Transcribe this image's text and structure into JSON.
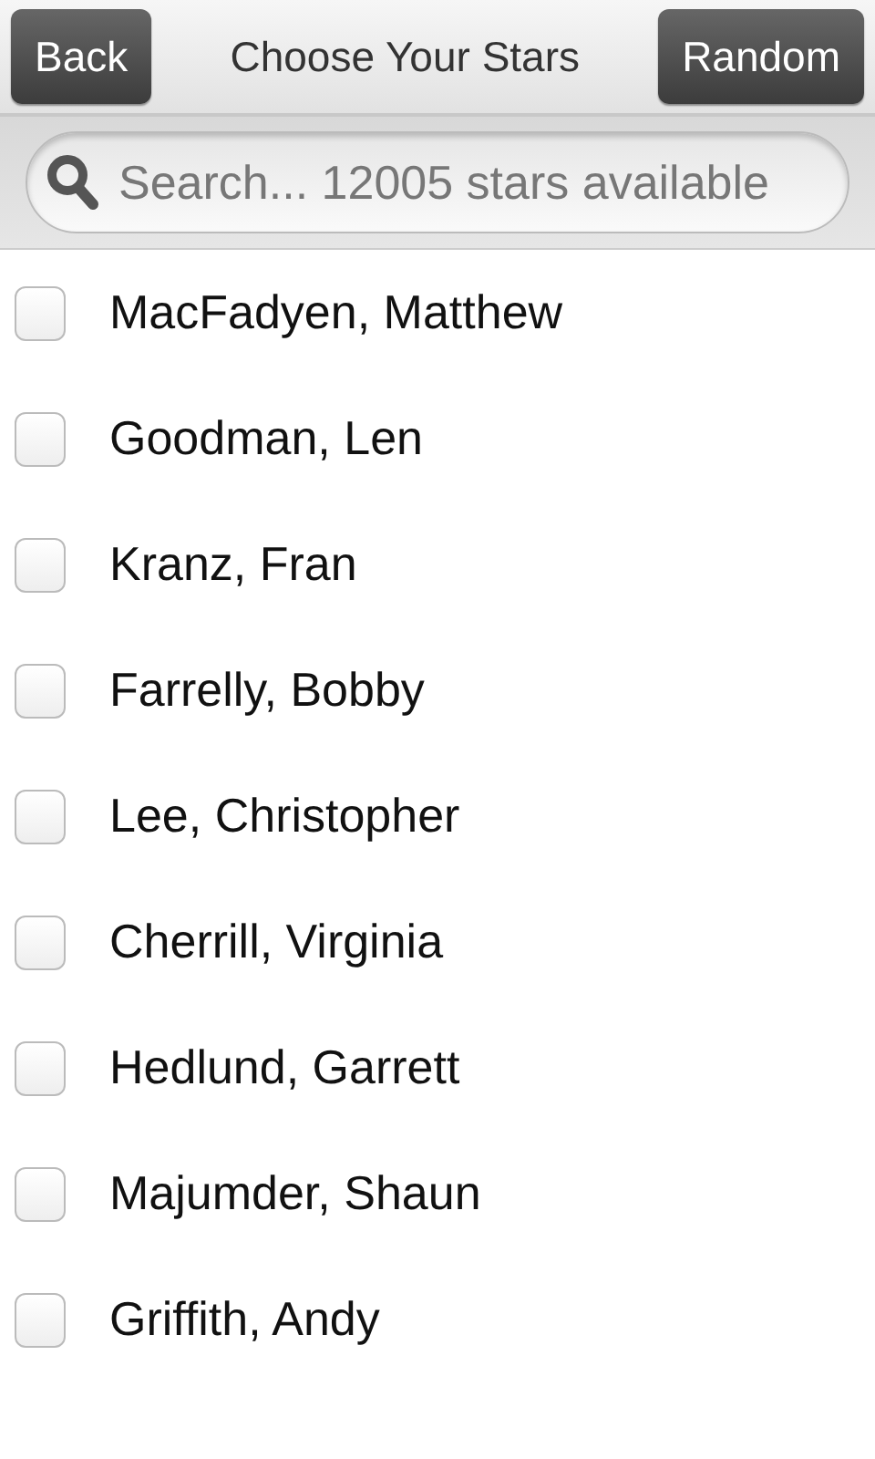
{
  "header": {
    "back": "Back",
    "title": "Choose Your Stars",
    "random": "Random"
  },
  "search": {
    "placeholder": "Search... 12005 stars available"
  },
  "stars": [
    {
      "name": "MacFadyen, Matthew",
      "checked": false
    },
    {
      "name": "Goodman, Len",
      "checked": false
    },
    {
      "name": "Kranz, Fran",
      "checked": false
    },
    {
      "name": "Farrelly, Bobby",
      "checked": false
    },
    {
      "name": "Lee, Christopher",
      "checked": false
    },
    {
      "name": "Cherrill, Virginia",
      "checked": false
    },
    {
      "name": "Hedlund, Garrett",
      "checked": false
    },
    {
      "name": "Majumder, Shaun",
      "checked": false
    },
    {
      "name": "Griffith, Andy",
      "checked": false
    }
  ]
}
